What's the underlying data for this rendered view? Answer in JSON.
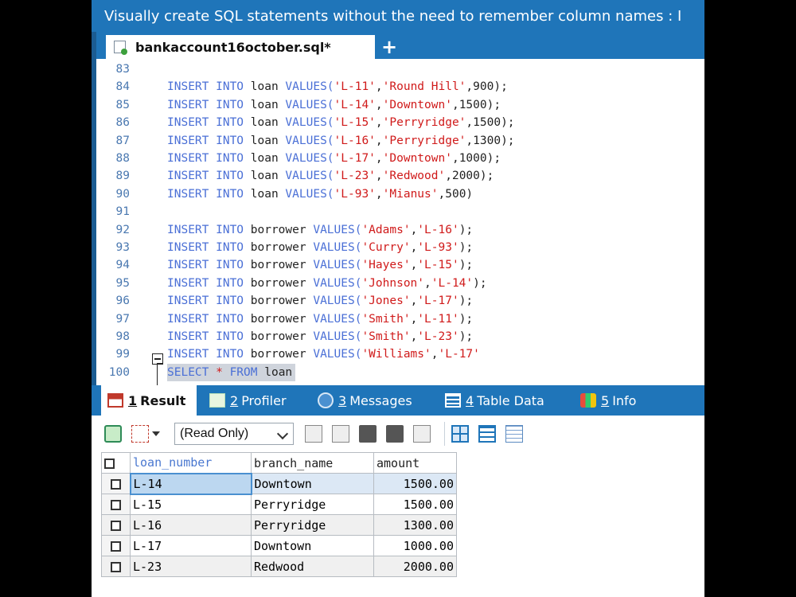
{
  "banner": {
    "text": "Visually create SQL statements without the need to remember column names : I"
  },
  "file_tab": {
    "label": "bankaccount16october.sql*",
    "add_label": "+"
  },
  "editor": {
    "lines": [
      {
        "n": "83",
        "tokens": []
      },
      {
        "n": "84",
        "tokens": [
          {
            "t": "kw",
            "v": "INSERT INTO "
          },
          {
            "t": "tx",
            "v": "loan "
          },
          {
            "t": "kw",
            "v": "VALUES("
          },
          {
            "t": "st",
            "v": "'L-11'"
          },
          {
            "t": "tx",
            "v": ","
          },
          {
            "t": "st",
            "v": "'Round Hill'"
          },
          {
            "t": "tx",
            "v": ",900);"
          }
        ]
      },
      {
        "n": "85",
        "tokens": [
          {
            "t": "kw",
            "v": "INSERT INTO "
          },
          {
            "t": "tx",
            "v": "loan "
          },
          {
            "t": "kw",
            "v": "VALUES("
          },
          {
            "t": "st",
            "v": "'L-14'"
          },
          {
            "t": "tx",
            "v": ","
          },
          {
            "t": "st",
            "v": "'Downtown'"
          },
          {
            "t": "tx",
            "v": ",1500);"
          }
        ]
      },
      {
        "n": "86",
        "tokens": [
          {
            "t": "kw",
            "v": "INSERT INTO "
          },
          {
            "t": "tx",
            "v": "loan "
          },
          {
            "t": "kw",
            "v": "VALUES("
          },
          {
            "t": "st",
            "v": "'L-15'"
          },
          {
            "t": "tx",
            "v": ","
          },
          {
            "t": "st",
            "v": "'Perryridge'"
          },
          {
            "t": "tx",
            "v": ",1500);"
          }
        ]
      },
      {
        "n": "87",
        "tokens": [
          {
            "t": "kw",
            "v": "INSERT INTO "
          },
          {
            "t": "tx",
            "v": "loan "
          },
          {
            "t": "kw",
            "v": "VALUES("
          },
          {
            "t": "st",
            "v": "'L-16'"
          },
          {
            "t": "tx",
            "v": ","
          },
          {
            "t": "st",
            "v": "'Perryridge'"
          },
          {
            "t": "tx",
            "v": ",1300);"
          }
        ]
      },
      {
        "n": "88",
        "tokens": [
          {
            "t": "kw",
            "v": "INSERT INTO "
          },
          {
            "t": "tx",
            "v": "loan "
          },
          {
            "t": "kw",
            "v": "VALUES("
          },
          {
            "t": "st",
            "v": "'L-17'"
          },
          {
            "t": "tx",
            "v": ","
          },
          {
            "t": "st",
            "v": "'Downtown'"
          },
          {
            "t": "tx",
            "v": ",1000);"
          }
        ]
      },
      {
        "n": "89",
        "tokens": [
          {
            "t": "kw",
            "v": "INSERT INTO "
          },
          {
            "t": "tx",
            "v": "loan "
          },
          {
            "t": "kw",
            "v": "VALUES("
          },
          {
            "t": "st",
            "v": "'L-23'"
          },
          {
            "t": "tx",
            "v": ","
          },
          {
            "t": "st",
            "v": "'Redwood'"
          },
          {
            "t": "tx",
            "v": ",2000);"
          }
        ]
      },
      {
        "n": "90",
        "tokens": [
          {
            "t": "kw",
            "v": "INSERT INTO "
          },
          {
            "t": "tx",
            "v": "loan "
          },
          {
            "t": "kw",
            "v": "VALUES("
          },
          {
            "t": "st",
            "v": "'L-93'"
          },
          {
            "t": "tx",
            "v": ","
          },
          {
            "t": "st",
            "v": "'Mianus'"
          },
          {
            "t": "tx",
            "v": ",500)"
          }
        ]
      },
      {
        "n": "91",
        "tokens": []
      },
      {
        "n": "92",
        "tokens": [
          {
            "t": "kw",
            "v": "INSERT INTO "
          },
          {
            "t": "tx",
            "v": "borrower "
          },
          {
            "t": "kw",
            "v": "VALUES("
          },
          {
            "t": "st",
            "v": "'Adams'"
          },
          {
            "t": "tx",
            "v": ","
          },
          {
            "t": "st",
            "v": "'L-16'"
          },
          {
            "t": "tx",
            "v": ");"
          }
        ]
      },
      {
        "n": "93",
        "tokens": [
          {
            "t": "kw",
            "v": "INSERT INTO "
          },
          {
            "t": "tx",
            "v": "borrower "
          },
          {
            "t": "kw",
            "v": "VALUES("
          },
          {
            "t": "st",
            "v": "'Curry'"
          },
          {
            "t": "tx",
            "v": ","
          },
          {
            "t": "st",
            "v": "'L-93'"
          },
          {
            "t": "tx",
            "v": ");"
          }
        ]
      },
      {
        "n": "94",
        "tokens": [
          {
            "t": "kw",
            "v": "INSERT INTO "
          },
          {
            "t": "tx",
            "v": "borrower "
          },
          {
            "t": "kw",
            "v": "VALUES("
          },
          {
            "t": "st",
            "v": "'Hayes'"
          },
          {
            "t": "tx",
            "v": ","
          },
          {
            "t": "st",
            "v": "'L-15'"
          },
          {
            "t": "tx",
            "v": ");"
          }
        ]
      },
      {
        "n": "95",
        "tokens": [
          {
            "t": "kw",
            "v": "INSERT INTO "
          },
          {
            "t": "tx",
            "v": "borrower "
          },
          {
            "t": "kw",
            "v": "VALUES("
          },
          {
            "t": "st",
            "v": "'Johnson'"
          },
          {
            "t": "tx",
            "v": ","
          },
          {
            "t": "st",
            "v": "'L-14'"
          },
          {
            "t": "tx",
            "v": ");"
          }
        ]
      },
      {
        "n": "96",
        "tokens": [
          {
            "t": "kw",
            "v": "INSERT INTO "
          },
          {
            "t": "tx",
            "v": "borrower "
          },
          {
            "t": "kw",
            "v": "VALUES("
          },
          {
            "t": "st",
            "v": "'Jones'"
          },
          {
            "t": "tx",
            "v": ","
          },
          {
            "t": "st",
            "v": "'L-17'"
          },
          {
            "t": "tx",
            "v": ");"
          }
        ]
      },
      {
        "n": "97",
        "tokens": [
          {
            "t": "kw",
            "v": "INSERT INTO "
          },
          {
            "t": "tx",
            "v": "borrower "
          },
          {
            "t": "kw",
            "v": "VALUES("
          },
          {
            "t": "st",
            "v": "'Smith'"
          },
          {
            "t": "tx",
            "v": ","
          },
          {
            "t": "st",
            "v": "'L-11'"
          },
          {
            "t": "tx",
            "v": ");"
          }
        ]
      },
      {
        "n": "98",
        "tokens": [
          {
            "t": "kw",
            "v": "INSERT INTO "
          },
          {
            "t": "tx",
            "v": "borrower "
          },
          {
            "t": "kw",
            "v": "VALUES("
          },
          {
            "t": "st",
            "v": "'Smith'"
          },
          {
            "t": "tx",
            "v": ","
          },
          {
            "t": "st",
            "v": "'L-23'"
          },
          {
            "t": "tx",
            "v": ");"
          }
        ]
      },
      {
        "n": "99",
        "tokens": [
          {
            "t": "kw",
            "v": "INSERT INTO "
          },
          {
            "t": "tx",
            "v": "borrower "
          },
          {
            "t": "kw",
            "v": "VALUES("
          },
          {
            "t": "st",
            "v": "'Williams'"
          },
          {
            "t": "tx",
            "v": ","
          },
          {
            "t": "st",
            "v": "'L-17'"
          }
        ]
      },
      {
        "n": "100",
        "selected": true,
        "tokens": [
          {
            "t": "kw",
            "v": "SELECT "
          },
          {
            "t": "st",
            "v": "* "
          },
          {
            "t": "kw",
            "v": "FROM "
          },
          {
            "t": "tx",
            "v": "loan"
          }
        ]
      }
    ]
  },
  "result_tabs": [
    {
      "num": "1",
      "label": "Result",
      "icon": "result-grid-icon",
      "active": true
    },
    {
      "num": "2",
      "label": "Profiler",
      "icon": "profiler-icon",
      "active": false
    },
    {
      "num": "3",
      "label": "Messages",
      "icon": "info-circle-icon",
      "active": false
    },
    {
      "num": "4",
      "label": "Table Data",
      "icon": "table-icon",
      "active": false
    },
    {
      "num": "5",
      "label": "Info",
      "icon": "info-blocks-icon",
      "active": false
    }
  ],
  "toolbar": {
    "mode": "(Read Only)"
  },
  "grid": {
    "columns": [
      "loan_number",
      "branch_name",
      "amount"
    ],
    "rows": [
      [
        "L-14",
        "Downtown",
        "1500.00"
      ],
      [
        "L-15",
        "Perryridge",
        "1500.00"
      ],
      [
        "L-16",
        "Perryridge",
        "1300.00"
      ],
      [
        "L-17",
        "Downtown",
        "1000.00"
      ],
      [
        "L-23",
        "Redwood",
        "2000.00"
      ]
    ]
  },
  "colors": {
    "accent": "#1f75b9",
    "keyword": "#4a6fd6",
    "string": "#d01a1a"
  }
}
